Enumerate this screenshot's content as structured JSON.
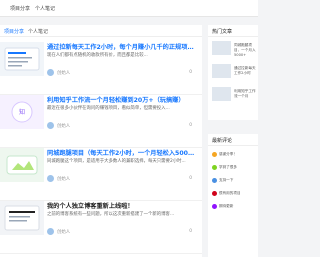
{
  "nav": {
    "items": [
      "项目分享",
      "个人笔记"
    ]
  },
  "tabs": [
    "项目分享",
    "个人笔记"
  ],
  "articles": [
    {
      "title": "通过拉新每天工作2小时，每个月赚小几千的正规项目！",
      "excerpt": "现在人们都有点随机的收款所有价，而且都是比较...",
      "author": "创始人",
      "comments": "0",
      "title_color": "#1677ff"
    },
    {
      "title": "利用知乎工作流一个月轻松赚到20万+（玩搞赚）",
      "excerpt": "最近在很多小伙伴在询问的赚钱项目，看似简单，但需要投入...",
      "author": "创始人",
      "comments": "0",
      "title_color": "#1677ff"
    },
    {
      "title": "同城跑腿项目（每天工作2小时，一个月轻松入5000+）",
      "excerpt": "同城跑腿这个项目，是适用于大多数人的兼职选择，每天只需要2小时...",
      "author": "创始人",
      "comments": "0",
      "title_color": "#1677ff"
    },
    {
      "title": "我的个人独立博客重新上线啦！",
      "excerpt": "之前的博客系统有一些问题，所以这次重新搭建了一个新的博客...",
      "author": "创始人",
      "comments": "0",
      "title_color": "#222222"
    }
  ],
  "sidebar": {
    "hot_title": "热门文章",
    "hot_items": [
      "同城跑腿项目，一个月入5000+",
      "通过拉新每天工作2小时",
      "利用知乎工作流一个月"
    ],
    "comment_title": "最新评论",
    "comments": [
      {
        "text": "感谢分享！",
        "color": "#f5a623"
      },
      {
        "text": "学到了很多",
        "color": "#7ed321"
      },
      {
        "text": "支持一下",
        "color": "#4a90e2"
      },
      {
        "text": "很有用的项目",
        "color": "#d0021b"
      },
      {
        "text": "期待更新",
        "color": "#9013fe"
      }
    ]
  }
}
